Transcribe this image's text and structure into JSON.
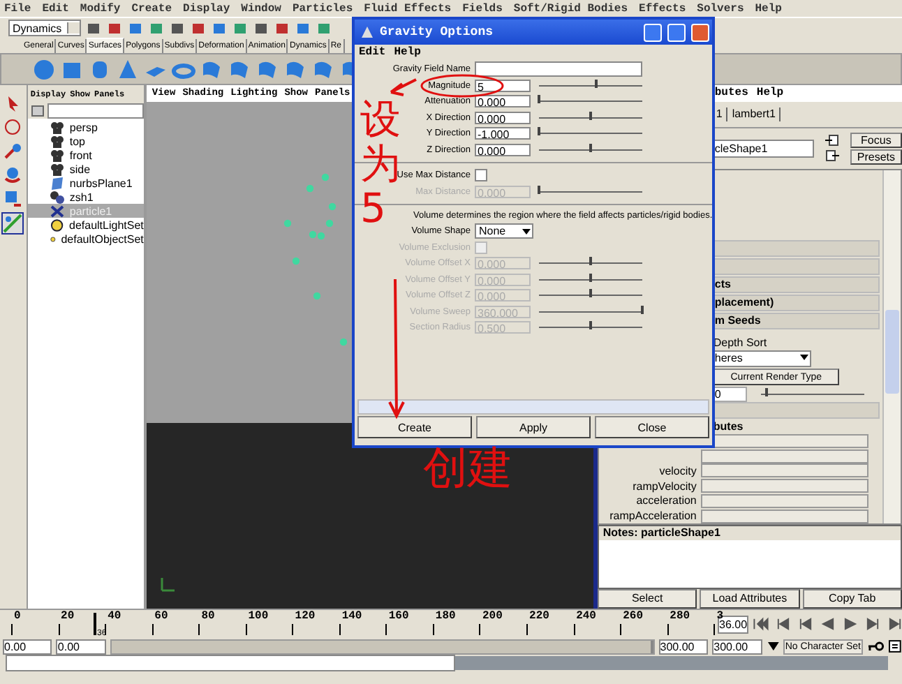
{
  "menu_bar": [
    "File",
    "Edit",
    "Modify",
    "Create",
    "Display",
    "Window",
    "Particles",
    "Fluid Effects",
    "Fields",
    "Soft/Rigid Bodies",
    "Effects",
    "Solvers",
    "Help"
  ],
  "status_line": {
    "menu_set": "Dynamics"
  },
  "shelf": {
    "tabs": [
      {
        "label": "General",
        "selected": false
      },
      {
        "label": "Curves",
        "selected": false
      },
      {
        "label": "Surfaces",
        "selected": true
      },
      {
        "label": "Polygons",
        "selected": false
      },
      {
        "label": "Subdivs",
        "selected": false
      },
      {
        "label": "Deformation",
        "selected": false
      },
      {
        "label": "Animation",
        "selected": false
      },
      {
        "label": "Dynamics",
        "selected": false
      },
      {
        "label": "Re",
        "selected": false
      }
    ]
  },
  "outliner": {
    "menu": [
      "Display",
      "Show",
      "Panels"
    ],
    "items": [
      {
        "label": "persp",
        "kind": "camera",
        "selected": false
      },
      {
        "label": "top",
        "kind": "camera",
        "selected": false
      },
      {
        "label": "front",
        "kind": "camera",
        "selected": false
      },
      {
        "label": "side",
        "kind": "camera",
        "selected": false
      },
      {
        "label": "nurbsPlane1",
        "kind": "surface",
        "selected": false
      },
      {
        "label": "zsh1",
        "kind": "field",
        "selected": false
      },
      {
        "label": "particle1",
        "kind": "particle",
        "selected": true
      },
      {
        "label": "defaultLightSet",
        "kind": "set",
        "selected": false
      },
      {
        "label": "defaultObjectSet",
        "kind": "set",
        "selected": false
      }
    ]
  },
  "viewport": {
    "menu": [
      "View",
      "Shading",
      "Lighting",
      "Show",
      "Panels"
    ]
  },
  "attribute_editor": {
    "menu": [
      "butes",
      "Help"
    ],
    "tabs": [
      "1",
      "lambert1"
    ],
    "node_name": "cleShape1",
    "buttons": [
      "Focus",
      "Presets"
    ],
    "rows": [
      {
        "kind": "section"
      },
      {
        "kind": "section"
      },
      {
        "kind": "section",
        "label": "cts"
      },
      {
        "kind": "section",
        "label": "placement)"
      },
      {
        "kind": "section",
        "label": "m Seeds"
      },
      {
        "kind": "label",
        "label": "Depth Sort"
      },
      {
        "kind": "dropdown",
        "value": "heres"
      },
      {
        "kind": "button",
        "label": "Current Render Type"
      },
      {
        "kind": "slider",
        "value": "0",
        "level": 0.05
      },
      {
        "kind": "section"
      },
      {
        "kind": "header",
        "label": "butes"
      },
      {
        "kind": "attr"
      },
      {
        "kind": "attr"
      },
      {
        "kind": "attr",
        "label": "velocity"
      },
      {
        "kind": "attr",
        "label": "rampVelocity"
      },
      {
        "kind": "attr",
        "label": "acceleration"
      },
      {
        "kind": "attr",
        "label": "rampAcceleration"
      }
    ],
    "notes_title": "Notes: particleShape1",
    "footer_buttons": [
      "Select",
      "Load Attributes",
      "Copy Tab"
    ]
  },
  "dialog": {
    "title": "Gravity Options",
    "menu": [
      "Edit",
      "Help"
    ],
    "rows": [
      {
        "kind": "text",
        "label": "Gravity Field Name",
        "disabled": false
      },
      {
        "kind": "float",
        "label": "Magnitude",
        "value": "5",
        "level": 0.55,
        "disabled": false
      },
      {
        "kind": "float",
        "label": "Attenuation",
        "value": "0.000",
        "level": 0,
        "disabled": false
      },
      {
        "kind": "float",
        "label": "X Direction",
        "value": "0.000",
        "level": 0.5,
        "disabled": false
      },
      {
        "kind": "float",
        "label": "Y Direction",
        "value": "-1.000",
        "level": 0,
        "disabled": false
      },
      {
        "kind": "float",
        "label": "Z Direction",
        "value": "0.000",
        "level": 0.5,
        "disabled": false
      },
      {
        "kind": "separator"
      },
      {
        "kind": "check",
        "label": "Use Max Distance",
        "checked": false,
        "disabled": false
      },
      {
        "kind": "float",
        "label": "Max Distance",
        "value": "0.000",
        "level": 0,
        "disabled": true
      },
      {
        "kind": "separator"
      },
      {
        "kind": "note",
        "label": "Volume determines the region where the field affects particles/rigid bodies."
      },
      {
        "kind": "dropdown",
        "label": "Volume Shape",
        "value": "None",
        "disabled": false
      },
      {
        "kind": "check",
        "label": "Volume Exclusion",
        "checked": false,
        "disabled": true
      },
      {
        "kind": "float",
        "label": "Volume Offset X",
        "value": "0.000",
        "level": 0.5,
        "disabled": true
      },
      {
        "kind": "float",
        "label": "Volume Offset Y",
        "value": "0.000",
        "level": 0.5,
        "disabled": true
      },
      {
        "kind": "float",
        "label": "Volume Offset Z",
        "value": "0.000",
        "level": 0.5,
        "disabled": true
      },
      {
        "kind": "float",
        "label": "Volume Sweep",
        "value": "360.000",
        "level": 1,
        "disabled": true
      },
      {
        "kind": "float",
        "label": "Section Radius",
        "value": "0.500",
        "level": 0.5,
        "disabled": true
      }
    ],
    "buttons": [
      "Create",
      "Apply",
      "Close"
    ]
  },
  "annotations": {
    "vertical_note": "设为5",
    "bottom_note": "创建"
  },
  "time_slider": {
    "ticks": [
      "0",
      "20",
      "40",
      "60",
      "80",
      "100",
      "120",
      "140",
      "160",
      "180",
      "200",
      "220",
      "240",
      "260",
      "280",
      "3"
    ],
    "playhead_label": "36",
    "level": 0.12,
    "current_time": "36.00"
  },
  "range_slider": {
    "start": "0.00",
    "range_start": "0.00",
    "range_end": "300.00",
    "end": "300.00",
    "character_set": "No Character Set",
    "level": 1
  }
}
